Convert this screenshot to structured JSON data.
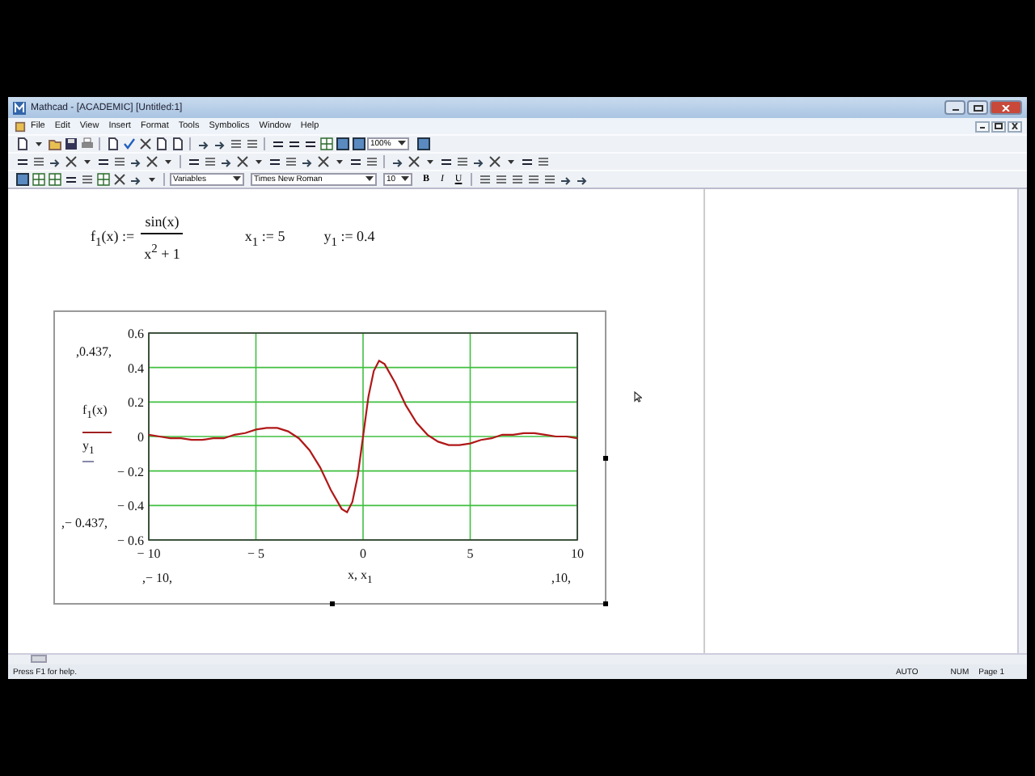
{
  "window": {
    "title": "Mathcad - [ACADEMIC] [Untitled:1]"
  },
  "menu": [
    "File",
    "Edit",
    "View",
    "Insert",
    "Format",
    "Tools",
    "Symbolics",
    "Window",
    "Help"
  ],
  "toolbar": {
    "zoom": "100%",
    "style": "Variables",
    "font": "Times New Roman",
    "size": "10",
    "format_buttons": [
      "B",
      "I",
      "U"
    ]
  },
  "equations": [
    {
      "kind": "fraction",
      "lhs": "f$_{1}$(x) :=",
      "numerator": "sin(x)",
      "denominator": "x$^{2}$ + 1"
    },
    {
      "kind": "plain",
      "text": "x$_{1}$ := 5"
    },
    {
      "kind": "plain",
      "text": "y$_{1}$ := 0.4"
    }
  ],
  "plot": {
    "y_max_label": ",0.437,",
    "y_min_label": ",− 0.437,",
    "x_min_label": ",− 10,",
    "x_max_label": ",10,",
    "trace_label": "f$_{1}$(x)",
    "point_label": "y$_{1}$",
    "x_label": "x, x$_{1}$",
    "chart_data": {
      "type": "line",
      "x": [
        -10,
        -9.5,
        -9,
        -8.5,
        -8,
        -7.5,
        -7,
        -6.5,
        -6,
        -5.5,
        -5,
        -4.5,
        -4,
        -3.5,
        -3,
        -2.5,
        -2,
        -1.5,
        -1,
        -0.75,
        -0.5,
        -0.25,
        0,
        0.25,
        0.5,
        0.75,
        1,
        1.5,
        2,
        2.5,
        3,
        3.5,
        4,
        4.5,
        5,
        5.5,
        6,
        6.5,
        7,
        7.5,
        8,
        8.5,
        9,
        9.5,
        10
      ],
      "series": [
        {
          "color": "#b01818",
          "values": [
            0.01,
            0,
            -0.01,
            -0.01,
            -0.02,
            -0.02,
            -0.01,
            -0.01,
            0.01,
            0.02,
            0.04,
            0.05,
            0.05,
            0.03,
            -0.01,
            -0.08,
            -0.18,
            -0.31,
            -0.42,
            -0.44,
            -0.38,
            -0.23,
            0,
            0.23,
            0.38,
            0.44,
            0.42,
            0.31,
            0.18,
            0.08,
            0.01,
            -0.03,
            -0.05,
            -0.05,
            -0.04,
            -0.02,
            -0.01,
            0.01,
            0.01,
            0.02,
            0.02,
            0.01,
            0,
            0,
            -0.01
          ]
        }
      ],
      "grid": true,
      "xlim": [
        -10,
        10
      ],
      "ylim": [
        -0.6,
        0.6
      ],
      "xticks": [
        {
          "value": -10,
          "label": "− 10"
        },
        {
          "value": -5,
          "label": "− 5"
        },
        {
          "value": 0,
          "label": "0"
        },
        {
          "value": 5,
          "label": "5"
        },
        {
          "value": 10,
          "label": "10"
        }
      ],
      "yticks": [
        {
          "value": 0.6,
          "label": "0.6"
        },
        {
          "value": 0.4,
          "label": "0.4"
        },
        {
          "value": 0.2,
          "label": "0.2"
        },
        {
          "value": 0,
          "label": "0"
        },
        {
          "value": -0.2,
          "label": "− 0.2"
        },
        {
          "value": -0.4,
          "label": "− 0.4"
        },
        {
          "value": -0.6,
          "label": "− 0.6"
        }
      ]
    }
  },
  "status_bar": {
    "help": "Press F1 for help.",
    "mode": "AUTO",
    "keys": "NUM",
    "page": "Page 1"
  }
}
